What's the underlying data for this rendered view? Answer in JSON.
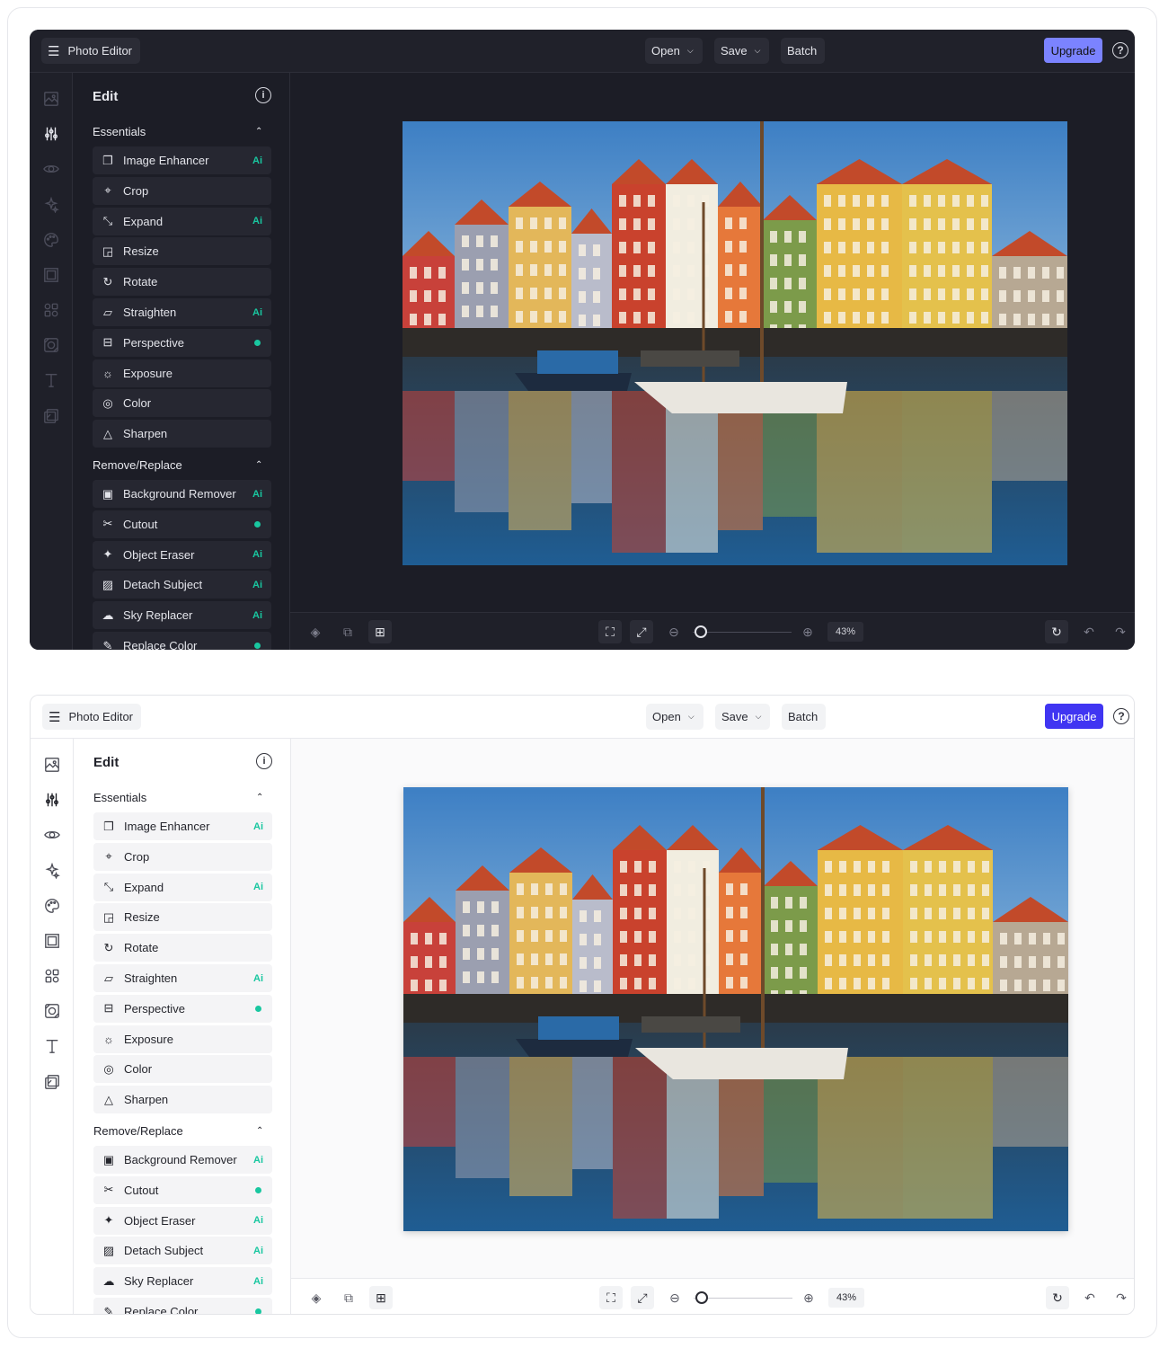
{
  "header": {
    "app_name": "Photo Editor",
    "open_label": "Open",
    "save_label": "Save",
    "batch_label": "Batch",
    "upgrade_label": "Upgrade",
    "help_icon": "?"
  },
  "rail_icons": [
    "image-icon",
    "sliders-icon",
    "eye-icon",
    "sparkles-icon",
    "palette-icon",
    "frame-icon",
    "elements-icon",
    "texture-icon",
    "text-icon",
    "overlay-icon"
  ],
  "panel": {
    "title": "Edit",
    "info_icon": "i",
    "sections": [
      {
        "label": "Essentials",
        "items": [
          {
            "label": "Image Enhancer",
            "badge": "ai"
          },
          {
            "label": "Crop",
            "badge": ""
          },
          {
            "label": "Expand",
            "badge": "ai"
          },
          {
            "label": "Resize",
            "badge": ""
          },
          {
            "label": "Rotate",
            "badge": ""
          },
          {
            "label": "Straighten",
            "badge": "ai"
          },
          {
            "label": "Perspective",
            "badge": "dot"
          },
          {
            "label": "Exposure",
            "badge": ""
          },
          {
            "label": "Color",
            "badge": ""
          },
          {
            "label": "Sharpen",
            "badge": ""
          }
        ]
      },
      {
        "label": "Remove/Replace",
        "items": [
          {
            "label": "Background Remover",
            "badge": "ai"
          },
          {
            "label": "Cutout",
            "badge": "dot"
          },
          {
            "label": "Object Eraser",
            "badge": "ai"
          },
          {
            "label": "Detach Subject",
            "badge": "ai"
          },
          {
            "label": "Sky Replacer",
            "badge": "ai"
          },
          {
            "label": "Replace Color",
            "badge": "dot"
          }
        ]
      }
    ],
    "ai_badge_text": "Ai"
  },
  "bottombar": {
    "zoom_value": "43%",
    "zoom_fraction": 0.05
  },
  "colors": {
    "accent_green": "#19c7a0",
    "upgrade_dark": "#7b83ff",
    "upgrade_light": "#4035f2"
  },
  "themes": [
    "dark",
    "light"
  ]
}
